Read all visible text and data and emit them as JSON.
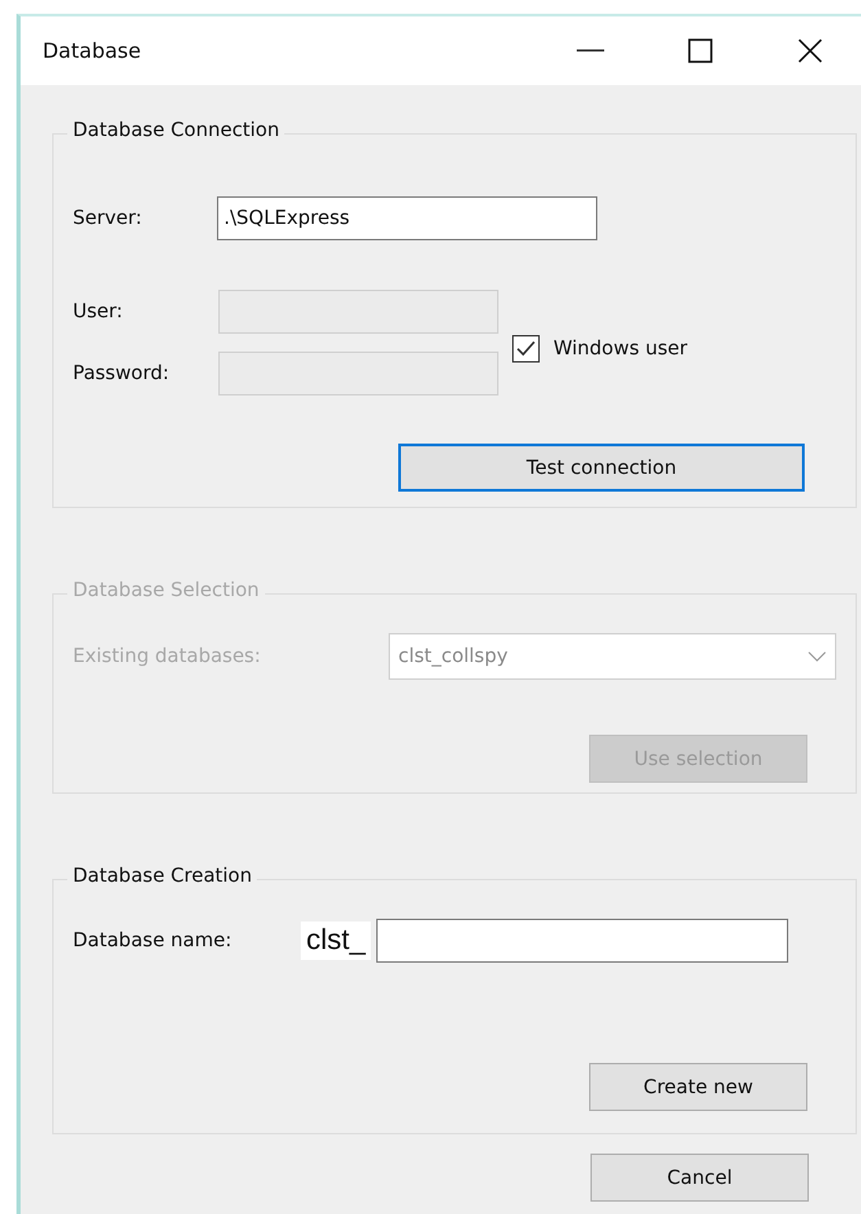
{
  "window": {
    "title": "Database"
  },
  "connection": {
    "title": "Database Connection",
    "server": {
      "label": "Server:",
      "value": ".\\SQLExpress"
    },
    "user": {
      "label": "User:",
      "disabled": true
    },
    "password": {
      "label": "Password:",
      "disabled": true
    },
    "windows_user": {
      "label": "Windows user",
      "checked": true
    },
    "test_button": {
      "label": "Test connection",
      "focused": true
    }
  },
  "selection": {
    "title": "Database Selection",
    "disabled": true,
    "existing": {
      "label": "Existing databases:",
      "value": "clst_collspy"
    },
    "button": {
      "label": "Use selection"
    }
  },
  "creation": {
    "title": "Database Creation",
    "name": {
      "label": "Database name:",
      "prefix": "clst_"
    },
    "button": {
      "label": "Create new"
    }
  },
  "cancel_button": {
    "label": "Cancel"
  }
}
